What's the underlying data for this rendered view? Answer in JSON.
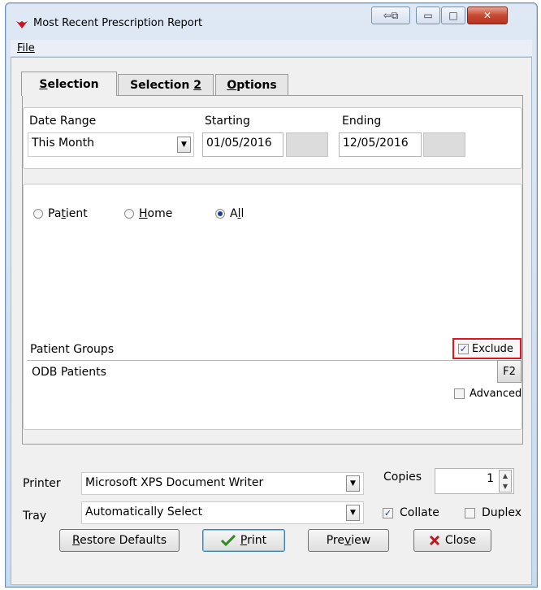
{
  "window": {
    "title": "Most Recent Prescription Report"
  },
  "titlebar_buttons": {
    "restore_glyph": "⇦⧉",
    "minimize_glyph": "▭",
    "maximize_glyph": "□",
    "close_glyph": "✕"
  },
  "menu": {
    "file": "File"
  },
  "tabs": [
    {
      "label": "Selection",
      "accel": "S",
      "rest": "election"
    },
    {
      "label": "Selection 2",
      "pre": "Selection ",
      "accel": "2"
    },
    {
      "label": "Options",
      "accel": "O",
      "rest": "ptions"
    }
  ],
  "date": {
    "range_label": "Date Range",
    "range_value": "This Month",
    "starting_label": "Starting",
    "starting_value": "01/05/2016",
    "ending_label": "Ending",
    "ending_value": "12/05/2016"
  },
  "filter": {
    "patient": {
      "pre": "Pa",
      "accel": "t",
      "post": "ient"
    },
    "home": {
      "accel": "H",
      "post": "ome"
    },
    "all": {
      "pre": "A",
      "accel": "l",
      "post": "l"
    },
    "selected": "All"
  },
  "patient_groups": {
    "label": "Patient Groups",
    "exclude_label": "Exclude",
    "exclude_checked": true,
    "value": "ODB Patients",
    "f2_label": "F2",
    "advanced_label": "Advanced",
    "advanced_checked": false
  },
  "printer": {
    "label": "Printer",
    "value": "Microsoft XPS Document Writer",
    "copies_label": "Copies",
    "copies_value": "1",
    "tray_label": "Tray",
    "tray_value": "Automatically Select",
    "collate_label": "Collate",
    "collate_checked": true,
    "duplex_label": "Duplex",
    "duplex_checked": false
  },
  "buttons": {
    "restore": {
      "accel": "R",
      "rest": "estore Defaults"
    },
    "print": {
      "accel": "P",
      "rest": "rint"
    },
    "preview": {
      "pre": "Pre",
      "accel": "v",
      "rest": "iew"
    },
    "close": {
      "label": "Close"
    }
  },
  "colors": {
    "highlight_box": "#e0141e",
    "check_blue": "#1a3a9a",
    "close_x": "#c0141e",
    "print_check": "#2e8b1e"
  }
}
